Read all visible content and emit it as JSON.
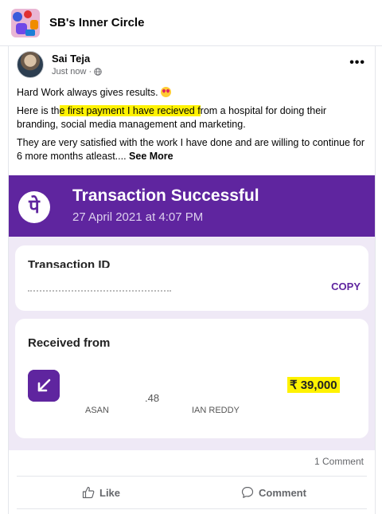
{
  "group": {
    "name": "SB's Inner Circle"
  },
  "post": {
    "author": "Sai Teja",
    "timestamp": "Just now ·",
    "line1": "Hard Work always gives results.",
    "p2_before": "Here is th",
    "p2_highlight": "e first payment I have recieved f",
    "p2_after": "rom a hospital for doing their branding, social media management and marketing.",
    "p3": "They are very satisfied with the work I have done and are willing to continue for 6 more months atleast....",
    "see_more": "See More"
  },
  "screenshot": {
    "logo_glyph": "पे",
    "title": "Transaction Successful",
    "date": "27 April 2021 at 4:07 PM",
    "tid_label": "Transaction ID",
    "copy_label": "COPY",
    "received_from_label": "Received from",
    "sender_fragment_1": ".48",
    "sender_fragment_2": "ASAN",
    "sender_fragment_3": "IAN REDDY",
    "amount": "₹ 39,000",
    "brand_color": "#5f259f"
  },
  "footer": {
    "comment_count": "1 Comment",
    "like_label": "Like",
    "comment_label": "Comment"
  },
  "icons": [
    "more-icon",
    "globe-icon",
    "heart-eyes-emoji-icon",
    "received-arrow-icon",
    "like-icon",
    "comment-icon"
  ]
}
